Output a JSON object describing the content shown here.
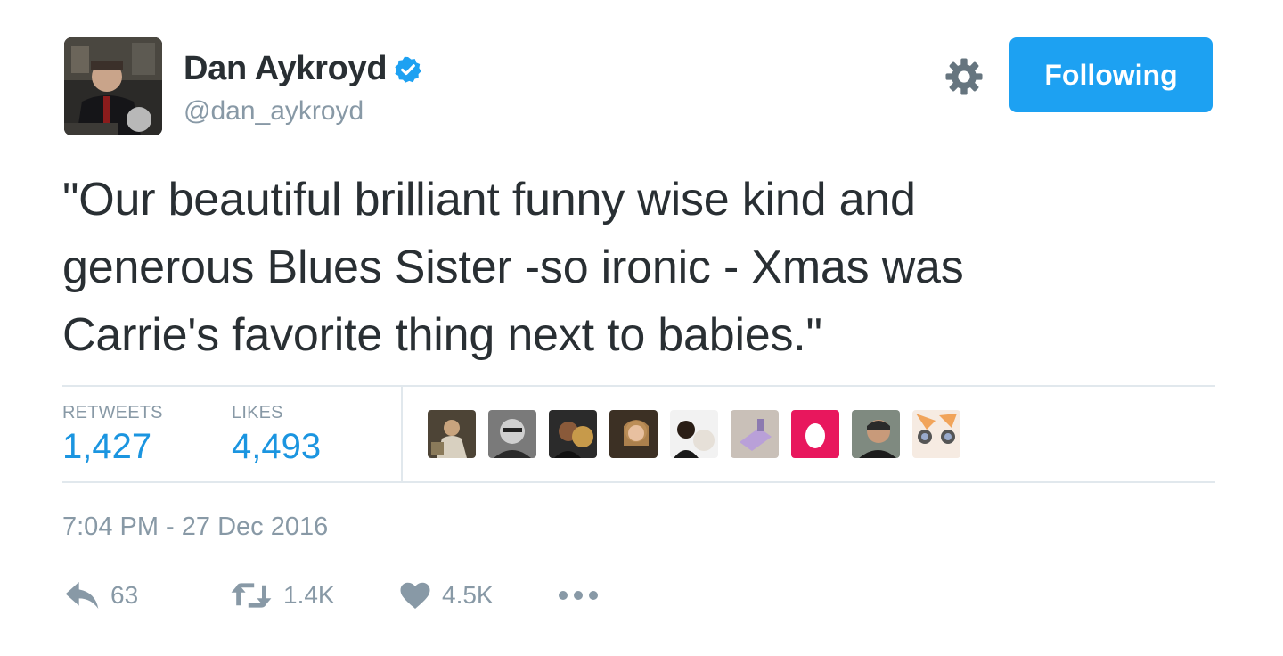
{
  "tweet": {
    "author": {
      "display_name": "Dan Aykroyd",
      "handle": "@dan_aykroyd",
      "verified_icon": "verified-badge-icon"
    },
    "follow_button_label": "Following",
    "settings_icon": "gear-icon",
    "text_lines": [
      "\"Our beautiful brilliant funny wise kind and",
      "generous Blues Sister -so ironic - Xmas was",
      "Carrie's favorite thing next to babies.\""
    ],
    "stats": {
      "retweets_label": "RETWEETS",
      "retweets_value": "1,427",
      "likes_label": "LIKES",
      "likes_value": "4,493"
    },
    "timestamp": "7:04 PM - 27 Dec 2016",
    "actions": {
      "reply_count": "63",
      "retweet_count": "1.4K",
      "like_count": "4.5K"
    }
  },
  "colors": {
    "brand_blue": "#1da1f2",
    "stat_blue": "#1b95e0",
    "muted_text": "#8899a6",
    "body_text": "#292f33",
    "divider": "#e1e8ed",
    "egg_avatar_pink": "#e8175d"
  }
}
